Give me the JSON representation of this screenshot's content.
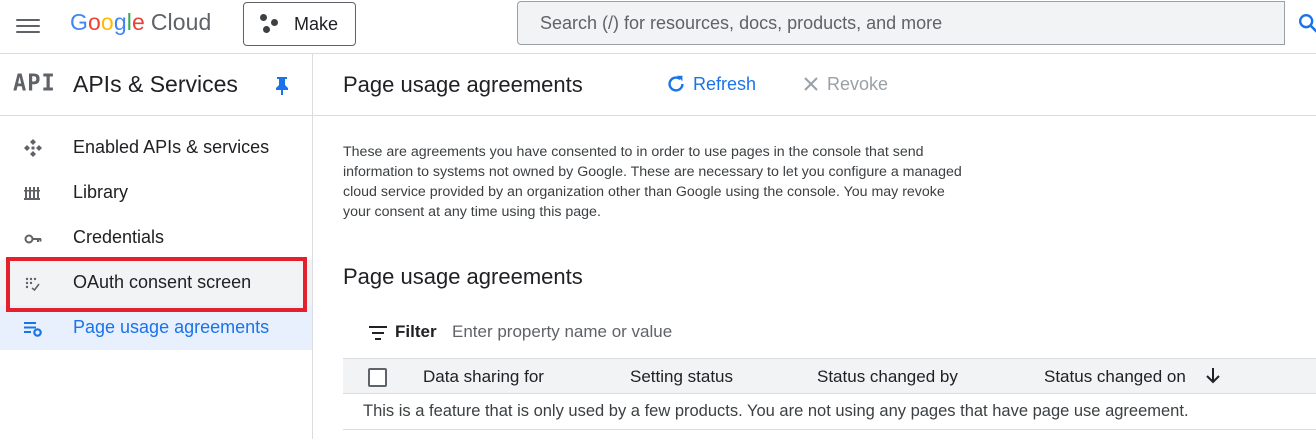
{
  "topbar": {
    "logo_google": "Google",
    "logo_cloud": "Cloud",
    "project_label": "Make",
    "search_placeholder": "Search (/) for resources, docs, products, and more"
  },
  "sidebar": {
    "icon_text": "API",
    "title": "APIs & Services",
    "items": [
      {
        "label": "Enabled APIs & services",
        "icon": "apis-icon"
      },
      {
        "label": "Library",
        "icon": "library-icon"
      },
      {
        "label": "Credentials",
        "icon": "key-icon"
      },
      {
        "label": "OAuth consent screen",
        "icon": "consent-icon"
      },
      {
        "label": "Page usage agreements",
        "icon": "settings-list-icon",
        "active": true
      }
    ]
  },
  "header": {
    "title": "Page usage agreements",
    "refresh_label": "Refresh",
    "revoke_label": "Revoke"
  },
  "main": {
    "description": "These are agreements you have consented to in order to use pages in the console that send information to systems not owned by Google. These are necessary to let you configure a managed cloud service provided by an organization other than Google using the console. You may revoke your consent at any time using this page.",
    "section_title": "Page usage agreements",
    "filter_label": "Filter",
    "filter_placeholder": "Enter property name or value",
    "columns": [
      "Data sharing for",
      "Setting status",
      "Status changed by",
      "Status changed on"
    ],
    "empty_message": "This is a feature that is only used by a few products. You are not using any pages that have page use agreement."
  },
  "colors": {
    "accent": "#1a73e8",
    "highlight_border": "#e3202c",
    "active_bg": "#e8f0fe"
  }
}
